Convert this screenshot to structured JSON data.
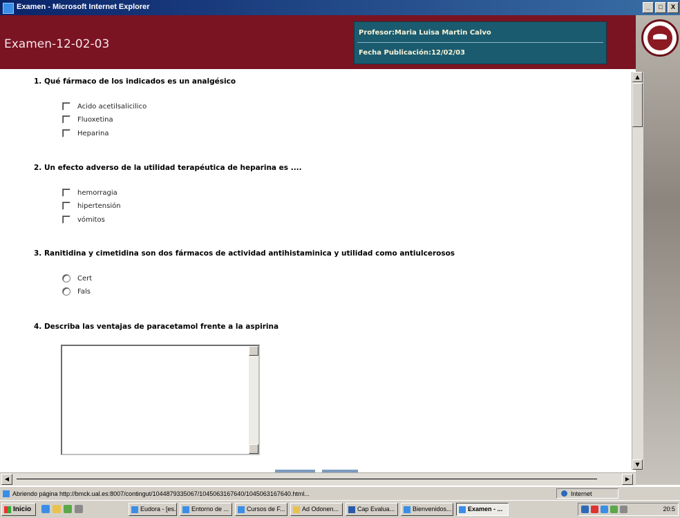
{
  "window": {
    "title": "Examen - Microsoft Internet Explorer",
    "buttons": [
      "_",
      "□",
      "X"
    ]
  },
  "header": {
    "exam_title": "Examen-12-02-03",
    "profesor": "Profesor:Maria Luisa Martin Calvo",
    "fecha": "Fecha Publicación:12/02/03"
  },
  "questions": [
    {
      "text": "1. Qué fármaco de los indicados es un analgésico",
      "type": "checkbox",
      "options": [
        "Acido acetilsalicilico",
        "Fluoxetina",
        "Heparina"
      ]
    },
    {
      "text": "2. Un efecto adverso de la utilidad terapéutica de heparina es ....",
      "type": "checkbox",
      "options": [
        "hemorragia",
        "hipertensión",
        "vómitos"
      ]
    },
    {
      "text": "3. Ranitidina y cimetidina son dos fármacos de actividad antihistaminica y utilidad como antiulcerosos",
      "type": "radio",
      "options": [
        "Cert",
        "Fals"
      ]
    },
    {
      "text": "4. Describa las ventajas de paracetamol frente a la aspirina",
      "type": "textarea",
      "value": ""
    }
  ],
  "status": {
    "text": "Abriendo página http://bmck.ual.es:8007/contingut/1044879335067/1045063167640/1045063167640.html...",
    "zone": "Internet"
  },
  "taskbar": {
    "start": "Inicio",
    "items": [
      "Eudora - [es...",
      "Entorno de ...",
      "Cursos de F...",
      "Ad Odonen...",
      "Cap Evalua...",
      "Bienvenidos...",
      "Examen - ..."
    ],
    "clock": "20:5"
  }
}
